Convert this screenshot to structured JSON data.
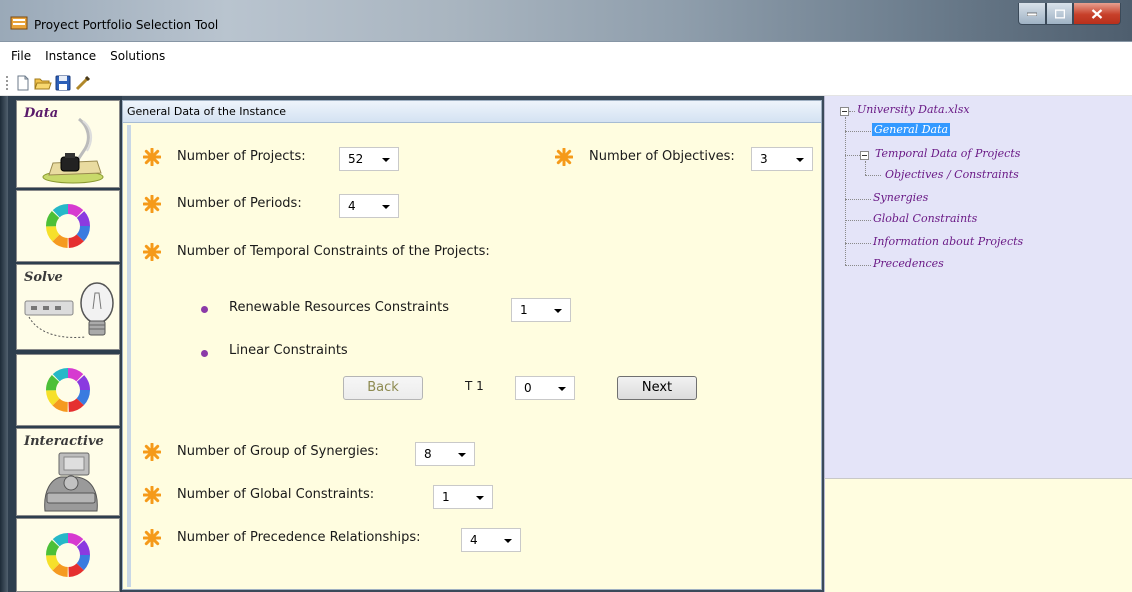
{
  "window": {
    "title": "Proyect Portfolio Selection Tool",
    "accent": "#3399ff"
  },
  "menu": [
    "File",
    "Instance",
    "Solutions"
  ],
  "toolbar": [
    "new-file-icon",
    "open-folder-icon",
    "save-icon",
    "wand-icon"
  ],
  "leftnav": {
    "tiles": [
      {
        "label": "Data",
        "icon": "ink-quill-icon"
      },
      {
        "label": "",
        "icon": "color-ring-icon"
      },
      {
        "label": "Solve",
        "icon": "lightbulb-icon"
      },
      {
        "label": "",
        "icon": "color-ring-icon"
      },
      {
        "label": "Interactive",
        "icon": "person-computer-icon"
      },
      {
        "label": "",
        "icon": "color-ring-icon"
      }
    ]
  },
  "panel": {
    "header": "General Data of the Instance",
    "projects": {
      "label": "Number of Projects:",
      "value": "52"
    },
    "objectives": {
      "label": "Number of Objectives:",
      "value": "3"
    },
    "periods": {
      "label": "Number of Periods:",
      "value": "4"
    },
    "temporal": {
      "label": "Number of Temporal Constraints of the Projects:"
    },
    "renewable": {
      "label": "Renewable Resources Constraints",
      "value": "1"
    },
    "linear": {
      "label": "Linear Constraints"
    },
    "nav": {
      "back": "Back",
      "period_label": "T 1",
      "period_value": "0",
      "next": "Next"
    },
    "synergies": {
      "label": "Number of Group of Synergies:",
      "value": "8"
    },
    "global": {
      "label": "Number of Global Constraints:",
      "value": "1"
    },
    "precedence": {
      "label": "Number of Precedence Relationships:",
      "value": "4"
    }
  },
  "tree": {
    "root": "University Data.xlsx",
    "items": [
      "General Data",
      "Temporal Data of Projects",
      "Objectives / Constraints",
      "Synergies",
      "Global Constraints",
      "Information about Projects",
      "Precedences"
    ]
  }
}
